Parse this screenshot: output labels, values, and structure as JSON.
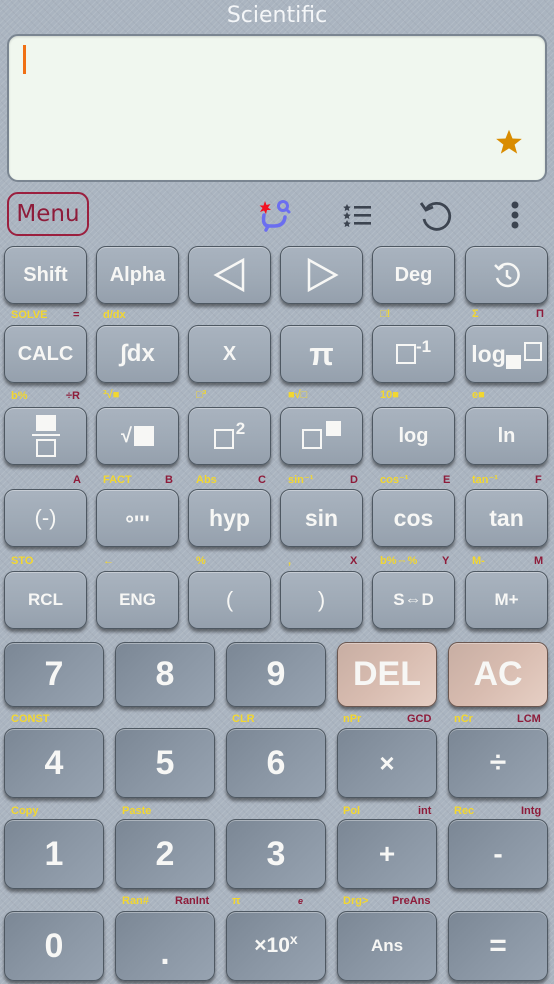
{
  "app": {
    "title": "Scientific"
  },
  "display": {
    "expression": "",
    "favorite_icon": "star-icon",
    "colors": {
      "cursor": "#f07014",
      "star": "#d98c00"
    }
  },
  "toolbar": {
    "menu_label": "Menu",
    "icons": [
      "ai-assistant-icon",
      "list-icon",
      "undo-icon",
      "more-vert-icon"
    ]
  },
  "keys": {
    "row1": [
      "Shift",
      "Alpha",
      "◁",
      "▷",
      "Deg",
      "history"
    ],
    "row1_shift": {
      "k1_y": "SOLVE",
      "k1_r": "=",
      "k2_y": "d/dx",
      "k5_y": "□!",
      "k6_y": "Σ",
      "k6_r": "Π"
    },
    "row2": [
      "CALC",
      "∫dx",
      "X",
      "π",
      "□⁻¹",
      "log□□"
    ],
    "row2_shift": {
      "k1_y": "b%",
      "k1_r": "÷R",
      "k2_y": "³√■",
      "k3_y": "□³",
      "k4_y": "■√□",
      "k5_y": "10■",
      "k6_y": "e■"
    },
    "row3": [
      "fraction",
      "√■",
      "□²",
      "□■",
      "log",
      "ln"
    ],
    "row3_shift": {
      "k1_r": "A",
      "k2_y": "FACT",
      "k2_r": "B",
      "k3_y": "Abs",
      "k3_r": "C",
      "k4_y": "sin⁻¹",
      "k4_r": "D",
      "k5_y": "cos⁻¹",
      "k5_r": "E",
      "k6_y": "tan⁻¹",
      "k6_r": "F"
    },
    "row4": [
      "(-)",
      "°'''",
      "hyp",
      "sin",
      "cos",
      "tan"
    ],
    "row4_shift": {
      "k1_y": "STO",
      "k2_y": "←",
      "k3_y": "%",
      "k4_y": ",",
      "k4_r": "X",
      "k5_y": "b%⇔%",
      "k5_r": "Y",
      "k6_y": "M-",
      "k6_r": "M"
    },
    "row5": [
      "RCL",
      "ENG",
      "(",
      ")",
      "S⇔D",
      "M+"
    ],
    "row6": [
      "7",
      "8",
      "9",
      "DEL",
      "AC"
    ],
    "row6_shift": {
      "k1_y": "CONST",
      "k3_y": "CLR",
      "k4_y": "nPr",
      "k4_r": "GCD",
      "k5_y": "nCr",
      "k5_r": "LCM"
    },
    "row7": [
      "4",
      "5",
      "6",
      "×",
      "÷"
    ],
    "row7_shift": {
      "k1_y": "Copy",
      "k2_y": "Paste",
      "k4_y": "Pol",
      "k4_r": "int",
      "k5_y": "Rec",
      "k5_r": "Intg"
    },
    "row8": [
      "1",
      "2",
      "3",
      "+",
      "-"
    ],
    "row8_shift": {
      "k2_y": "Ran#",
      "k2_r": "RanInt",
      "k3_y": "π",
      "k3_r": "e",
      "k4_y": "Drg>",
      "k4_r": "PreAns"
    },
    "row9": [
      "0",
      ".",
      "×10",
      "Ans",
      "="
    ],
    "row9_sup": "x"
  },
  "colors": {
    "shift_label": "#f2d730",
    "alpha_label": "#8e1c3a",
    "menu_border": "#9b1f3e",
    "key_gray": "#a2adb9",
    "key_num": "#8a96a4",
    "key_red": "#d8bcb0"
  }
}
